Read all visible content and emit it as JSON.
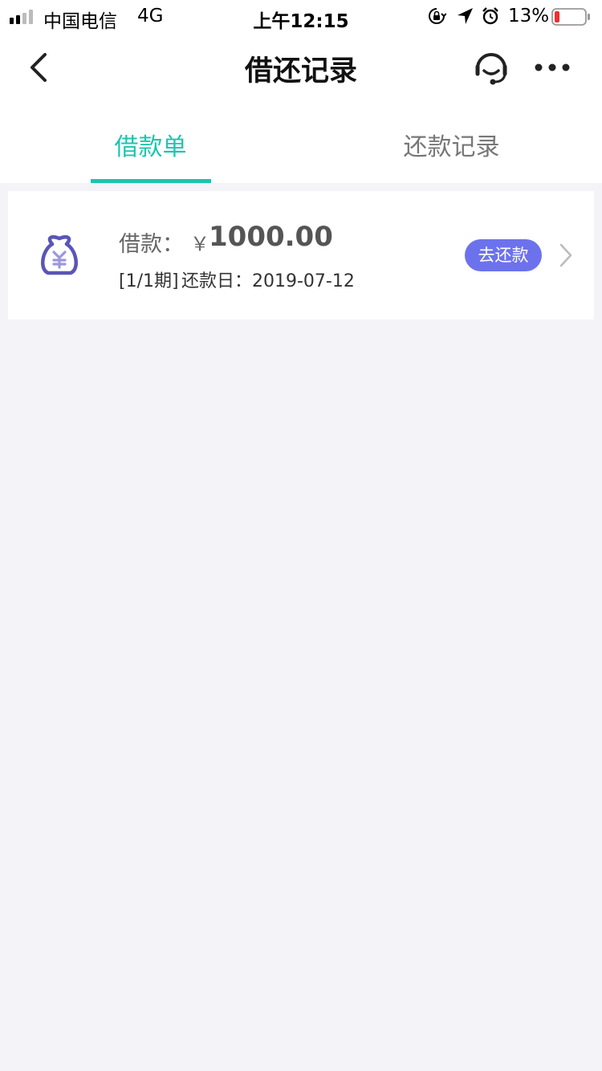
{
  "status_bar": {
    "carrier": "中国电信",
    "network": "4G",
    "time": "上午12:15",
    "battery_percent": "13%"
  },
  "nav": {
    "title": "借还记录",
    "icons": [
      "back-arrow-icon",
      "customer-service-icon",
      "more-icon"
    ]
  },
  "tabs": [
    {
      "label": "借款单",
      "active": true
    },
    {
      "label": "还款记录",
      "active": false
    }
  ],
  "loans": [
    {
      "label": "借款：",
      "currency": "￥",
      "amount": "1000.00",
      "term": "[1/1期]",
      "due_date": "还款日：2019-07-12",
      "action": "去还款",
      "icon": "money-bag-icon"
    }
  ],
  "colors": {
    "accent": "#1cc5ae",
    "button": "#6c72ec",
    "icon": "#5b55b8",
    "background": "#f3f3f8"
  }
}
